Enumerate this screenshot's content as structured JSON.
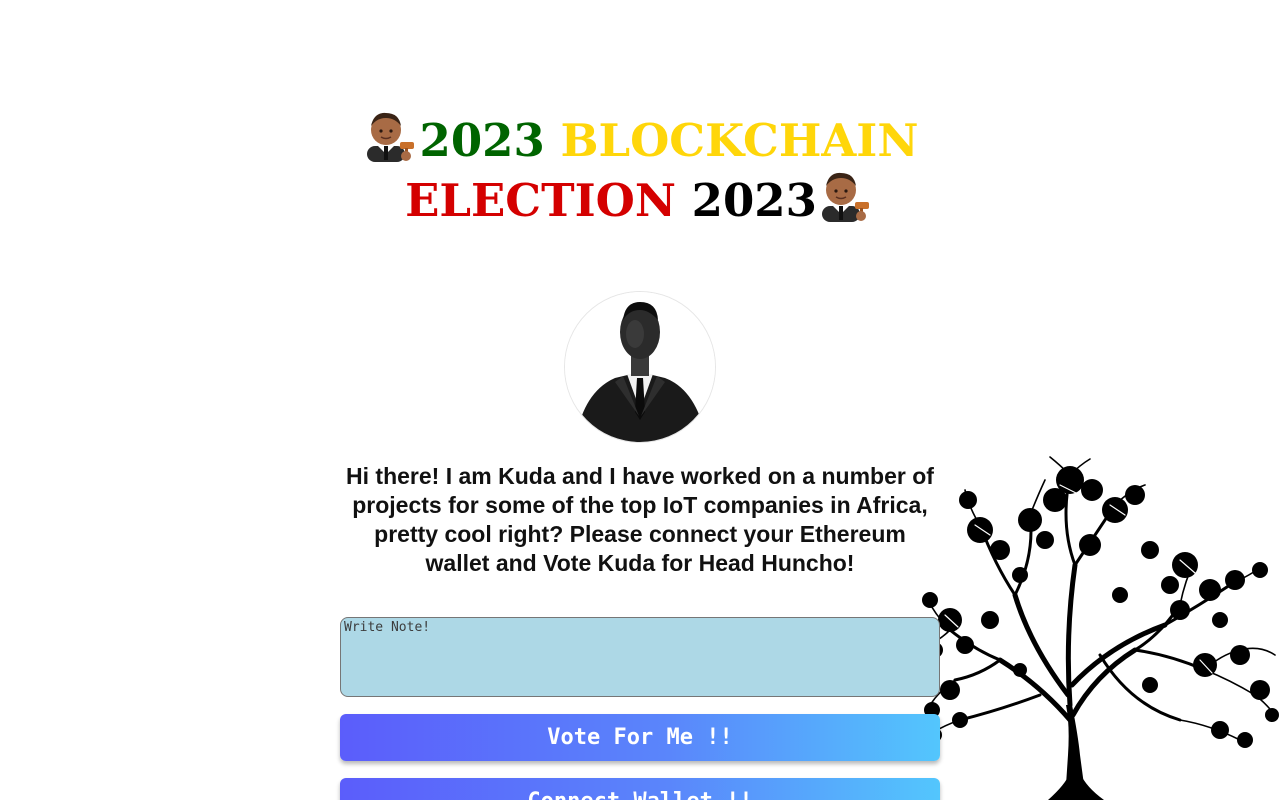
{
  "header": {
    "judge_icon": "man-judge-emoji-icon",
    "word_year_left": "2023",
    "word_blockchain": "BLOCKCHAIN",
    "word_election": "ELECTION",
    "word_year_right": "2023",
    "colors": {
      "green": "#006400",
      "gold": "#ffd60a",
      "red": "#d40000",
      "black": "#000000"
    }
  },
  "profile": {
    "avatar_icon": "candidate-portrait"
  },
  "bio": {
    "text": "Hi there! I am Kuda and I have worked on a number of projects for some of the top IoT companies in Africa, pretty cool right? Please connect your Ethereum wallet and Vote Kuda for Head Huncho!"
  },
  "note": {
    "placeholder": "Write Note!",
    "value": "",
    "background": "#add8e6"
  },
  "buttons": {
    "vote_label": "Vote For Me !!",
    "connect_label": "Connect Wallet !!",
    "gradient_start": "#5b5dfb",
    "gradient_end": "#53c6fd"
  },
  "decoration": {
    "tree_icon": "tree-silhouette-icon"
  }
}
